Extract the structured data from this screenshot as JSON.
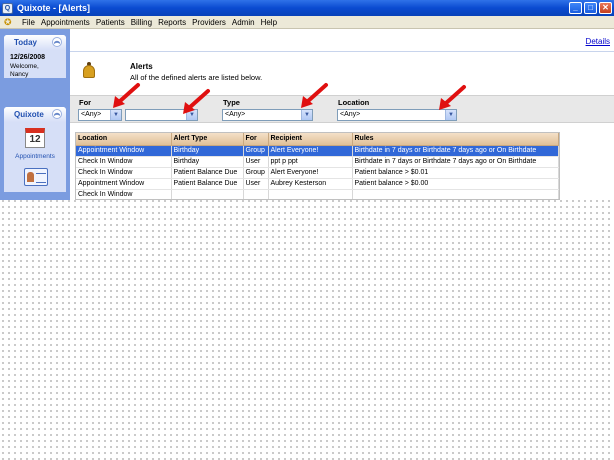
{
  "window": {
    "title": "Quixote - [Alerts]",
    "minimize": "_",
    "maximize": "□",
    "close": "✕",
    "app_icon": "Q"
  },
  "menubar": {
    "logo_icon": "quixote-logo-icon",
    "items": [
      "File",
      "Appointments",
      "Patients",
      "Billing",
      "Reports",
      "Providers",
      "Admin",
      "Help"
    ]
  },
  "sidebar": {
    "today": {
      "title": "Today",
      "date": "12/26/2008",
      "welcome": "Welcome,",
      "user": "Nancy"
    },
    "quixote": {
      "title": "Quixote",
      "calendar_number": "12",
      "appointments_label": "Appointments"
    }
  },
  "main": {
    "details_link": "Details",
    "alerts_title": "Alerts",
    "alerts_desc": "All of the defined alerts are listed below.",
    "filters": {
      "for_label": "For",
      "for_value": "<Any>",
      "for_second_value": "",
      "type_label": "Type",
      "type_value": "<Any>",
      "location_label": "Location",
      "location_value": "<Any>"
    },
    "table": {
      "headers": [
        "Location",
        "Alert Type",
        "For",
        "Recipient",
        "Rules"
      ],
      "rows": [
        [
          "Appointment Window",
          "Birthday",
          "Group",
          "Alert Everyone!",
          "Birthdate in 7 days or Birthdate 7 days ago or On Birthdate"
        ],
        [
          "Check In Window",
          "Birthday",
          "User",
          "ppt p ppt",
          "Birthdate in 7 days or Birthdate 7 days ago or On Birthdate"
        ],
        [
          "Check In Window",
          "Patient Balance Due",
          "Group",
          "Alert Everyone!",
          "Patient balance > $0.01"
        ],
        [
          "Appointment Window",
          "Patient Balance Due",
          "User",
          "Aubrey Kesterson",
          "Patient balance > $0.00"
        ],
        [
          "Check In Window",
          "",
          "",
          "",
          ""
        ]
      ]
    }
  },
  "colors": {
    "titlebar": "#0a4bd0",
    "selected_row": "#3168d8",
    "annotation_arrow": "#e01010",
    "sidebar": "#7b9ce0"
  }
}
